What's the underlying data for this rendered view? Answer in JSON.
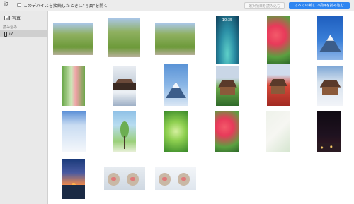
{
  "toolbar": {
    "device_name": "i7",
    "open_photos_label": "このデバイスを接続したときに\"写真\"を開く",
    "import_selected_label": "選択項目を読み込む",
    "import_all_label": "すべての新しい項目を読み込む"
  },
  "sidebar": {
    "photos_label": "写真",
    "section_label": "読み込み",
    "device_label": "i7"
  },
  "grid": {
    "items": [
      {
        "name": "ginkgo-avenue-photo-1",
        "kind": "ginkgo"
      },
      {
        "name": "ginkgo-avenue-photo-2",
        "kind": "ginkgo"
      },
      {
        "name": "ginkgo-avenue-photo-3",
        "kind": "ginkgo"
      },
      {
        "name": "lock-screen-photo",
        "kind": "lockscreen",
        "time": "10:35"
      },
      {
        "name": "autumn-leaves-photo-1",
        "kind": "autumn"
      },
      {
        "name": "mount-fuji-photo-1",
        "kind": "fuji-blue"
      },
      {
        "name": "kimono-photo",
        "kind": "kimono"
      },
      {
        "name": "snowy-bridge-photo",
        "kind": "snowbridge"
      },
      {
        "name": "mount-fuji-photo-2",
        "kind": "fuji-light"
      },
      {
        "name": "kiyomizu-temple-photo-1",
        "kind": "temple-green"
      },
      {
        "name": "kiyomizu-temple-photo-2",
        "kind": "temple-red"
      },
      {
        "name": "snowy-temple-photo",
        "kind": "temple-snow"
      },
      {
        "name": "snow-field-photo",
        "kind": "snowfield"
      },
      {
        "name": "green-tree-photo",
        "kind": "tree"
      },
      {
        "name": "fresh-leaves-photo",
        "kind": "leaves"
      },
      {
        "name": "autumn-leaves-photo-2",
        "kind": "autumn"
      },
      {
        "name": "map-screenshot",
        "kind": "map"
      },
      {
        "name": "tokyo-tower-night-photo",
        "kind": "tower"
      },
      {
        "name": "sunset-pier-photo",
        "kind": "sunset"
      },
      {
        "name": "snow-monkeys-photo-1",
        "kind": "monkeys"
      },
      {
        "name": "snow-monkeys-photo-2",
        "kind": "monkeys-light"
      }
    ]
  }
}
